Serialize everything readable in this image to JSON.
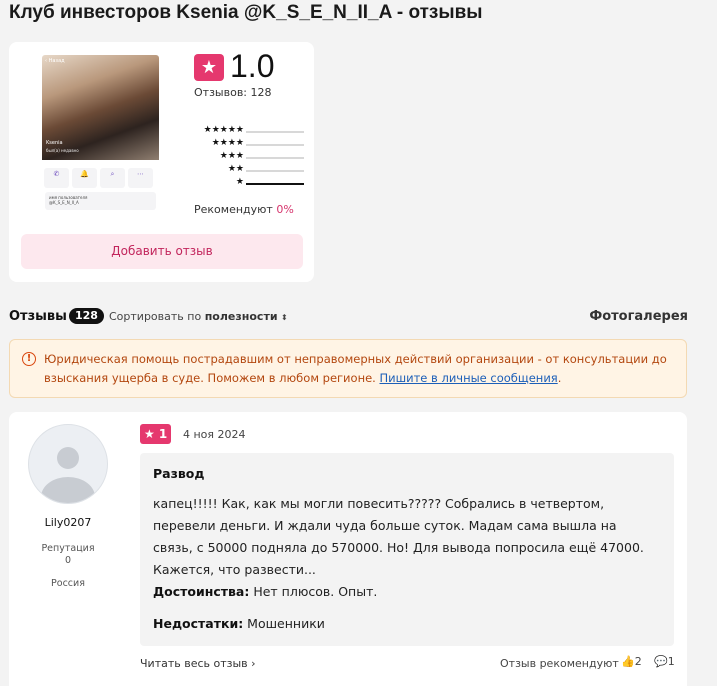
{
  "page_title": "Клуб инвесторов Ksenia @K_S_E_N_II_A - отзывы",
  "summary": {
    "rating": "1.0",
    "reviews_label": "Отзывов: 128",
    "star_distribution": [
      {
        "stars": "★★★★★",
        "fill": 0
      },
      {
        "stars": "★★★★",
        "fill": 0
      },
      {
        "stars": "★★★",
        "fill": 0
      },
      {
        "stars": "★★",
        "fill": 0
      },
      {
        "stars": "★",
        "fill": 1
      }
    ],
    "recommend_label": "Рекомендуют",
    "recommend_pct": "0%",
    "add_review": "Добавить отзыв",
    "phone": {
      "back": "‹ Назад",
      "name": "Ksenia",
      "sub": "был(а) недавно",
      "icons": [
        "✆",
        "🔔",
        "⌕",
        "⋯"
      ],
      "user_caption": "имя пользователя",
      "username": "@K_S_E_N_II_A"
    }
  },
  "reviews_bar": {
    "label": "Отзывы",
    "count": "128",
    "sort_prefix": "Сортировать по",
    "sort_value": "полезности",
    "sort_arrow": "⬍",
    "gallery": "Фотогалерея"
  },
  "notice": {
    "icon": "!",
    "text": "Юридическая помощь пострадавшим от неправомерных действий организации - от консультации до взыскания ущерба в суде. Поможем в любом регионе. ",
    "link": "Пишите в личные сообщения",
    "tail": "."
  },
  "review": {
    "user_name": "Lily0207",
    "reputation_label": "Репутация",
    "reputation_value": "0",
    "country": "Россия",
    "rating": "★ 1",
    "date": "4 ноя 2024",
    "title": "Развод",
    "text": "капец!!!!! Как, как мы могли повесить????? Собрались в четвертом, перевели деньги. И ждали чуда больше суток. Мадам сама вышла на связь, с 50000 подняла до 570000. Но! Для вывода попросила ещё 47000. Кажется, что развести...",
    "pros_label": "Достоинства:",
    "pros": " Нет плюсов. Опыт.",
    "cons_label": "Недостатки:",
    "cons": " Мошенники",
    "read_all": "Читать весь отзыв  ›",
    "recommends": "Отзыв рекомендуют",
    "likes": "👍2",
    "comments": "💬1"
  },
  "colors": {
    "accent": "#e5386e",
    "notice_bg": "#fff4e5",
    "notice_text": "#b3470f",
    "link": "#1c5fb8"
  }
}
